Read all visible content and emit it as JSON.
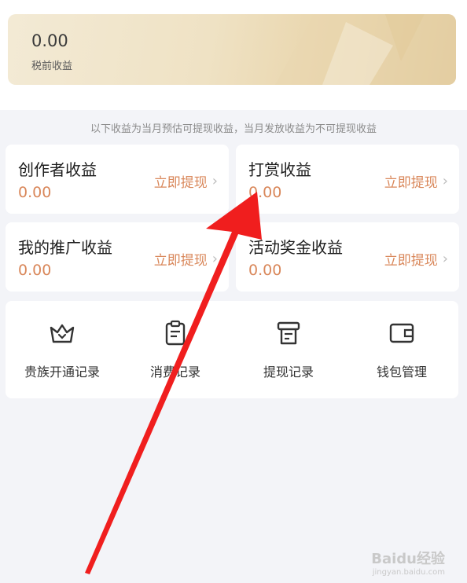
{
  "summary": {
    "amount": "0.00",
    "label": "税前收益"
  },
  "notice": "以下收益为当月预估可提现收益，当月发放收益为不可提现收益",
  "income_cards": [
    {
      "title": "创作者收益",
      "amount": "0.00",
      "action": "立即提现"
    },
    {
      "title": "打赏收益",
      "amount": "0.00",
      "action": "立即提现"
    },
    {
      "title": "我的推广收益",
      "amount": "0.00",
      "action": "立即提现"
    },
    {
      "title": "活动奖金收益",
      "amount": "0.00",
      "action": "立即提现"
    }
  ],
  "entries": [
    {
      "label": "贵族开通记录",
      "icon": "crown-icon"
    },
    {
      "label": "消费记录",
      "icon": "clipboard-icon"
    },
    {
      "label": "提现记录",
      "icon": "cashier-icon"
    },
    {
      "label": "钱包管理",
      "icon": "wallet-icon"
    }
  ],
  "watermark": {
    "main": "Baidu经验",
    "sub": "jingyan.baidu.com"
  },
  "colors": {
    "accent": "#d9875a",
    "background": "#f3f4f8",
    "arrow": "#f01e1e"
  }
}
